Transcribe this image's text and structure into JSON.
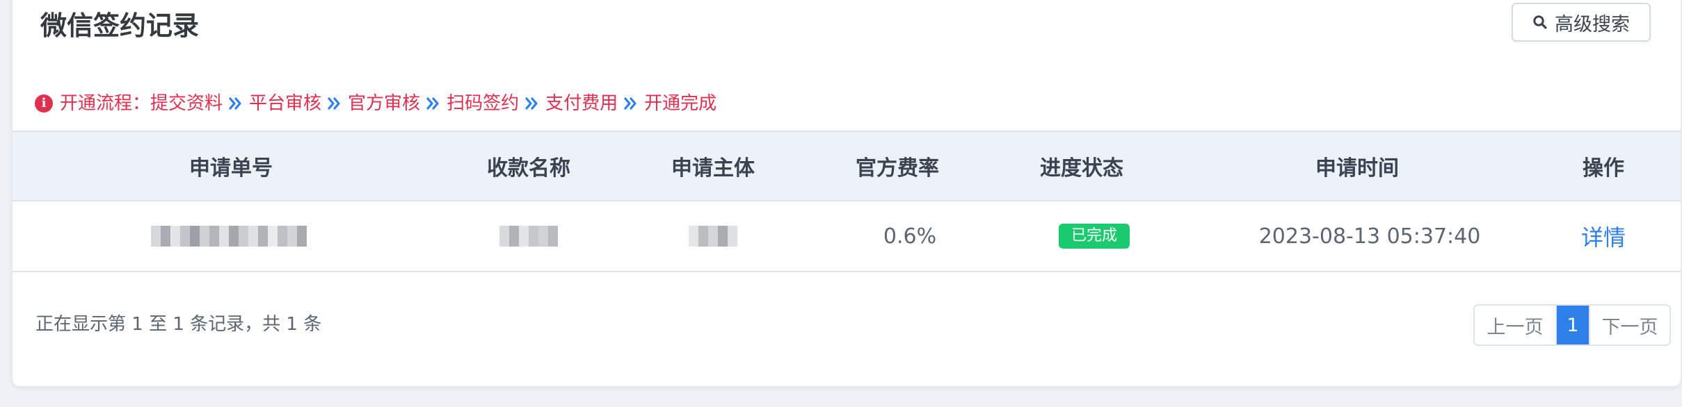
{
  "page": {
    "title": "微信签约记录",
    "advanced_search_label": "高级搜索"
  },
  "flow": {
    "prefix": "开通流程：",
    "steps": [
      "提交资料",
      "平台审核",
      "官方审核",
      "扫码签约",
      "支付费用",
      "开通完成"
    ]
  },
  "table": {
    "headers": [
      "申请单号",
      "收款名称",
      "申请主体",
      "官方费率",
      "进度状态",
      "申请时间",
      "操作"
    ],
    "rows": [
      {
        "order_no": "",
        "payee_name": "",
        "applicant": "",
        "rate": "0.6%",
        "status": "已完成",
        "time": "2023-08-13 05:37:40",
        "action": "详情"
      }
    ]
  },
  "footer": {
    "summary": "正在显示第 1 至 1 条记录，共 1 条",
    "prev_label": "上一页",
    "current_page": "1",
    "next_label": "下一页"
  },
  "colors": {
    "accent": "#2f7fe8",
    "alert": "#e0304f",
    "status_done": "#1bc96f"
  },
  "icons": {
    "search": "search-icon",
    "info": "info-icon",
    "chevron": "double-chevron-right-icon"
  }
}
